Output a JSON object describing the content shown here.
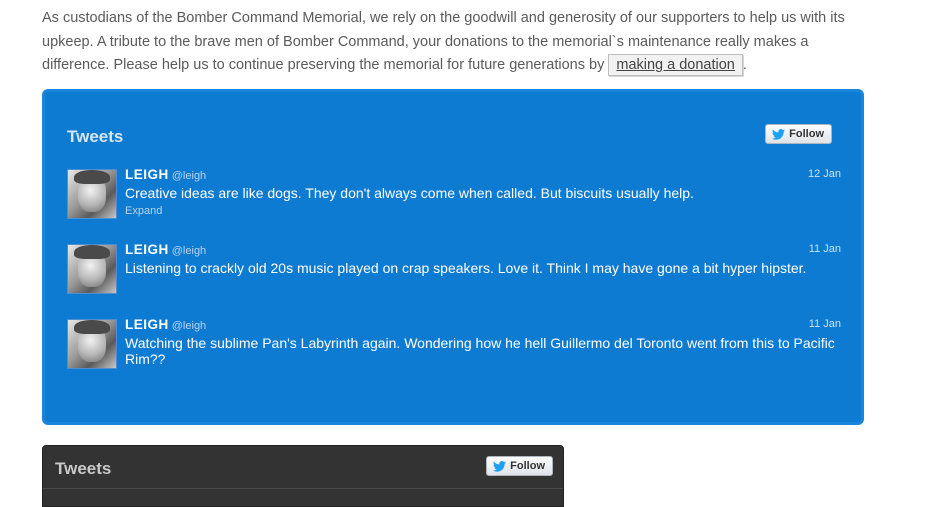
{
  "intro": {
    "text": "As custodians of the Bomber Command Memorial, we rely on the goodwill and generosity of our supporters to help us with its upkeep. A tribute to the brave men of Bomber Command, your donations to the memorial`s maintenance really makes a difference. Please help us to continue preserving the memorial for future generations by",
    "link_label": "making a donation",
    "trailing": "."
  },
  "widget_blue": {
    "title": "Tweets",
    "follow_label": "Follow",
    "tweets": [
      {
        "name": "LEIGH",
        "handle": "@leigh",
        "date": "12 Jan",
        "text": "Creative ideas are like dogs. They don't always come when called.  But biscuits usually help.",
        "expand": "Expand"
      },
      {
        "name": "LEIGH",
        "handle": "@leigh",
        "date": "11 Jan",
        "text": "Listening to crackly old 20s music played on crap speakers.  Love it. Think I may have gone a bit hyper hipster."
      },
      {
        "name": "LEIGH",
        "handle": "@leigh",
        "date": "11 Jan",
        "text": "Watching the sublime Pan's Labyrinth again. Wondering how he hell Guillermo del Toronto went from this to Pacific Rim??"
      }
    ]
  },
  "widget_dark": {
    "title": "Tweets",
    "follow_label": "Follow"
  },
  "colors": {
    "widget_blue_bg": "#0e7bd3",
    "widget_dark_bg": "#333333",
    "twitter_bird": "#1da1f2"
  },
  "icons": [
    "twitter-bird-icon",
    "avatar"
  ]
}
